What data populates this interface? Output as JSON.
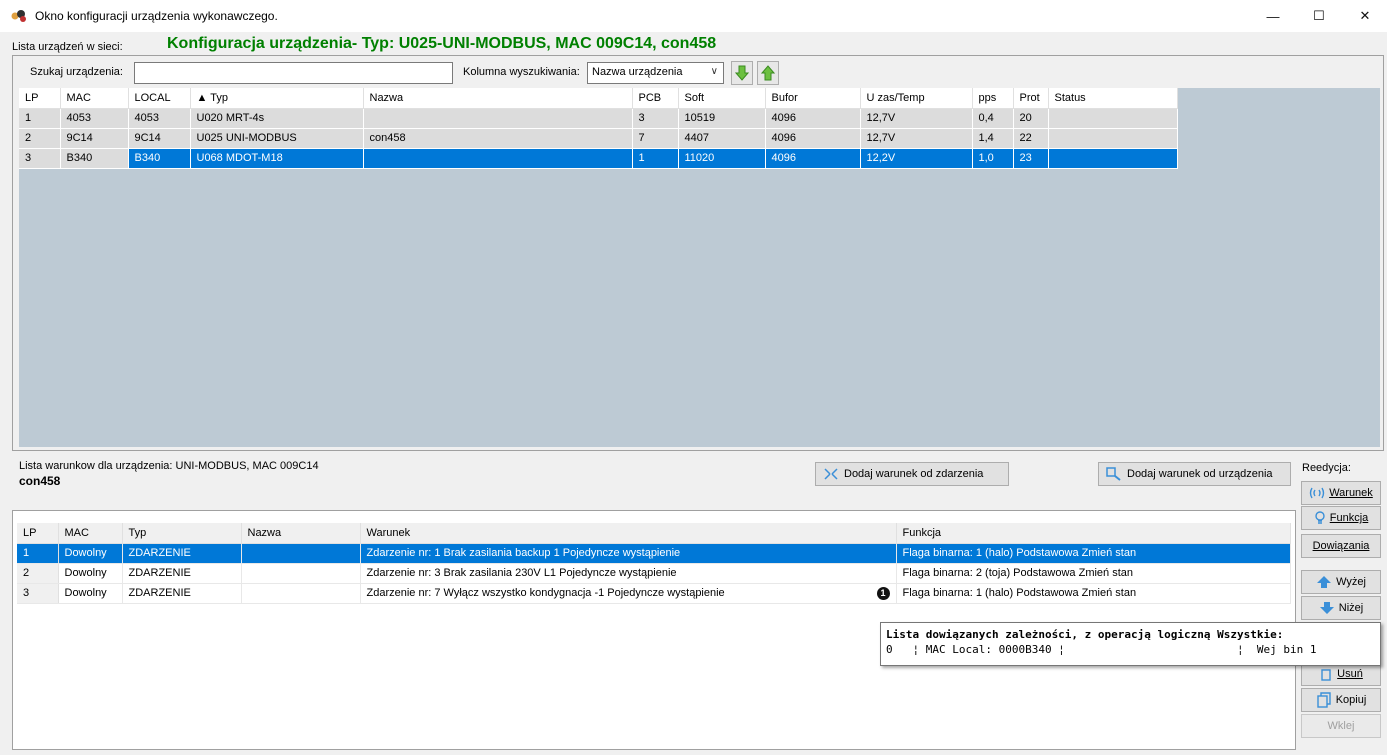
{
  "window": {
    "title": "Okno konfiguracji urządzenia wykonawczego.",
    "min": "—",
    "max": "☐",
    "close": "✕"
  },
  "device_list": {
    "label": "Lista urządzeń w sieci:",
    "config_title": "Konfiguracja urządzenia- Typ: U025-UNI-MODBUS, MAC 009C14, con458",
    "search_label": "Szukaj urządzenia:",
    "search_value": "",
    "column_label": "Kolumna wyszukiwania:",
    "column_value": "Nazwa urządzenia",
    "headers": [
      "LP",
      "MAC",
      "LOCAL",
      "▲ Typ",
      "Nazwa",
      "PCB",
      "Soft",
      "Bufor",
      "U zas/Temp",
      "pps",
      "Prot",
      "Status"
    ],
    "rows": [
      [
        "1",
        "4053",
        "4053",
        "U020 MRT-4s",
        "",
        "3",
        "10519",
        "4096",
        "12,7V",
        "0,4",
        "20",
        ""
      ],
      [
        "2",
        "9C14",
        "9C14",
        "U025 UNI-MODBUS",
        "con458",
        "7",
        "4407",
        "4096",
        "12,7V",
        "1,4",
        "22",
        ""
      ],
      [
        "3",
        "B340",
        "B340",
        "U068 MDOT-M18",
        "",
        "1",
        "11020",
        "4096",
        "12,2V",
        "1,0",
        "23",
        ""
      ]
    ],
    "selected_row": 2
  },
  "conditions": {
    "label": "Lista warunkow dla urządzenia: UNI-MODBUS, MAC 009C14",
    "name": "con458",
    "add_event_button": "Dodaj warunek od zdarzenia",
    "add_device_button": "Dodaj warunek od urządzenia",
    "headers": [
      "LP",
      "MAC",
      "Typ",
      "Nazwa",
      "Warunek",
      "Funkcja"
    ],
    "rows": [
      [
        "1",
        "Dowolny",
        "ZDARZENIE",
        "",
        "Zdarzenie nr: 1 Brak zasilania backup 1 Pojedyncze wystąpienie",
        "Flaga binarna:  1 (halo)  Podstawowa Zmień stan"
      ],
      [
        "2",
        "Dowolny",
        "ZDARZENIE",
        "",
        "Zdarzenie nr: 3 Brak zasilania 230V L1 Pojedyncze wystąpienie",
        "Flaga binarna:  2 (toja)  Podstawowa Zmień stan"
      ],
      [
        "3",
        "Dowolny",
        "ZDARZENIE",
        "",
        "Zdarzenie nr: 7 Wyłącz wszystko kondygnacja -1 Pojedyncze wystąpienie",
        "Flaga binarna:  1 (halo)  Podstawowa Zmień stan"
      ]
    ],
    "selected_row": 0,
    "badge": "1"
  },
  "side_panel": {
    "label": "Reedycja:",
    "buttons": {
      "warunek": "Warunek",
      "funkcja": "Funkcja",
      "dowiazania": "Dowiązania",
      "wyzej": "Wyżej",
      "nizej": "Niżej",
      "usun": "Usuń",
      "kopiuj": "Kopiuj",
      "wklej": "Wklej"
    }
  },
  "tooltip": {
    "line1": "Lista dowiązanych zależności, z operacją logiczną Wszystkie:",
    "line2": "0   ¦ MAC Local: 0000B340 ¦                          ¦  Wej bin 1"
  },
  "colors": {
    "title_green": "#008000",
    "selection_blue": "#0078d7",
    "grid_background": "#bdcad4"
  }
}
